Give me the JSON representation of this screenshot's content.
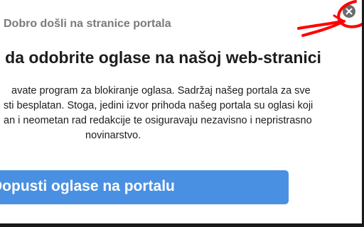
{
  "modal": {
    "title": "Dobro došli na stranice portala",
    "headline": "s da odobrite oglase na našoj web-stranici",
    "body_lines": [
      "avate program za blokiranje oglasa. Sadržaj našeg portala za sve",
      "sti besplatan. Stoga, jedini izvor prihoda našeg portala su oglasi koji",
      "an i neometan rad redakcije te osiguravaju nezavisno i nepristrasno",
      "novinarstvo."
    ],
    "cta_label": "Dopusti oglase na portalu",
    "close_icon": "close-icon"
  },
  "annotation": {
    "color": "#ff0000",
    "description_icon": "red-circle-arrow-annotation"
  },
  "colors": {
    "cta_background": "#4a90e2",
    "title_text": "#7a7a7a",
    "close_background": "#6b6b6b"
  }
}
